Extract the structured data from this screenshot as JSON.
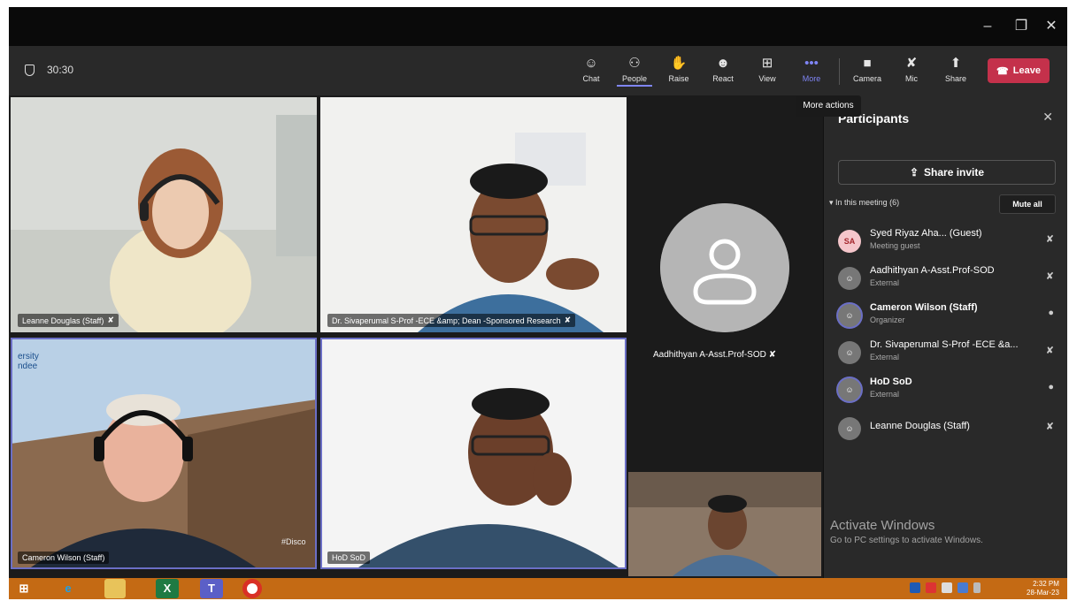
{
  "window": {
    "minimize": "–",
    "restore": "❐",
    "close": "✕"
  },
  "toolbar": {
    "timer": "30:30",
    "buttons": [
      {
        "key": "chat",
        "label": "Chat",
        "icon": "☺"
      },
      {
        "key": "people",
        "label": "People",
        "icon": "⚇"
      },
      {
        "key": "raise",
        "label": "Raise",
        "icon": "✋"
      },
      {
        "key": "react",
        "label": "React",
        "icon": "☻"
      },
      {
        "key": "view",
        "label": "View",
        "icon": "⊞"
      },
      {
        "key": "more",
        "label": "More",
        "icon": "•••"
      },
      {
        "key": "camera",
        "label": "Camera",
        "icon": "■"
      },
      {
        "key": "mic",
        "label": "Mic",
        "icon": "✘"
      },
      {
        "key": "share",
        "label": "Share",
        "icon": "⬆"
      }
    ],
    "leave_label": "Leave",
    "tooltip": "More actions"
  },
  "stage": {
    "tiles": [
      {
        "name": "Leanne Douglas (Staff)"
      },
      {
        "name": "Dr. Sivaperumal S-Prof -ECE &amp; Dean -Sponsored Research"
      },
      {
        "name": "Cameron Wilson (Staff)"
      },
      {
        "name": "HoD SoD"
      }
    ],
    "audio_only_name": "Aadhithyan A-Asst.Prof-SOD",
    "backdrop_text": [
      "ersity",
      "ndee"
    ],
    "hashtag": "#Disco"
  },
  "panel": {
    "title": "Participants",
    "share_invite": "Share invite",
    "in_meeting": "In this meeting (6)",
    "mute_all": "Mute all",
    "participants": [
      {
        "initials": "SA",
        "name": "Syed Riyaz Aha...  (Guest)",
        "role": "Meeting guest",
        "mic": "off"
      },
      {
        "initials": "",
        "name": "Aadhithyan A-Asst.Prof-SOD",
        "role": "External",
        "mic": "off"
      },
      {
        "initials": "",
        "name": "Cameron Wilson (Staff)",
        "role": "Organizer",
        "mic": "on"
      },
      {
        "initials": "",
        "name": "Dr. Sivaperumal S-Prof -ECE &a...",
        "role": "External",
        "mic": "off"
      },
      {
        "initials": "",
        "name": "HoD SoD",
        "role": "External",
        "mic": "on"
      },
      {
        "initials": "",
        "name": "Leanne Douglas (Staff)",
        "role": "",
        "mic": "off"
      }
    ]
  },
  "watermark": {
    "line1": "Activate Windows",
    "line2": "Go to PC settings to activate Windows."
  },
  "taskbar": {
    "apps": [
      "windows-start",
      "internet-explorer",
      "file-explorer",
      "excel",
      "teams",
      "chrome"
    ],
    "time": "2:32 PM",
    "date": "28-Mar-23"
  },
  "colors": {
    "accent": "#7f85f5",
    "leave": "#c4314b",
    "taskbar": "#c46a14",
    "panel": "#292929"
  }
}
